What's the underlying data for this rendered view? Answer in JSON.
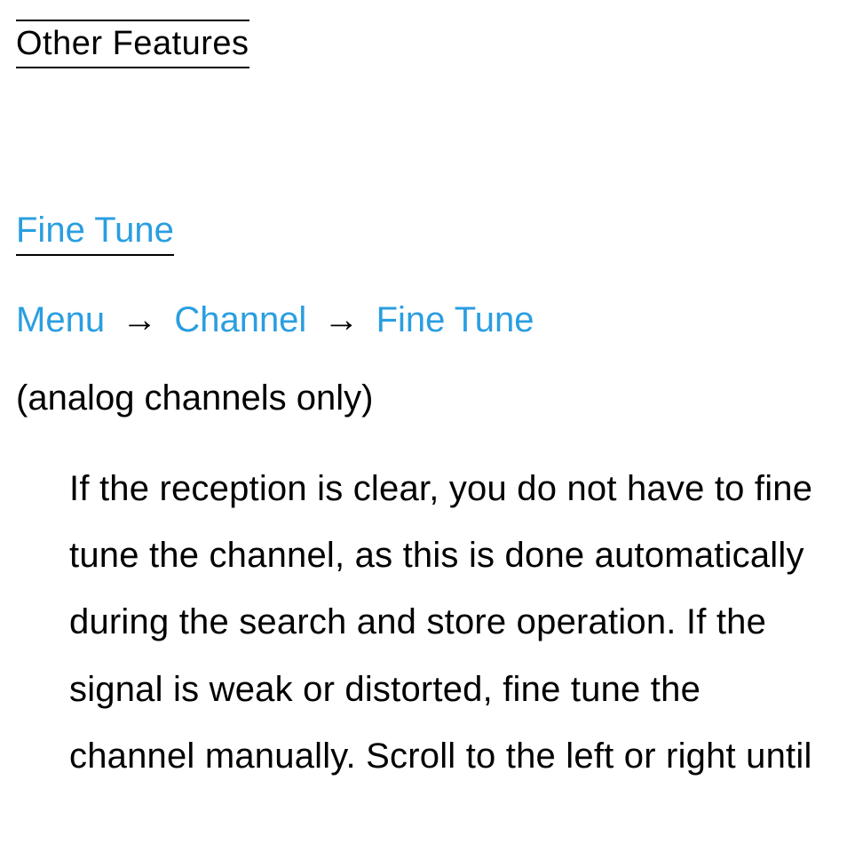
{
  "header": {
    "section_title": "Other Features"
  },
  "feature": {
    "title": "Fine Tune",
    "nav": {
      "step1": "Menu",
      "step2": "Channel",
      "step3": "Fine Tune",
      "sep": "→"
    },
    "note": "(analog channels only)",
    "body": "If the reception is clear, you do not have to fine tune the channel, as this is done automatically during the search and store operation. If the signal is weak or distorted, fine tune the channel manually. Scroll to the left or right until"
  }
}
